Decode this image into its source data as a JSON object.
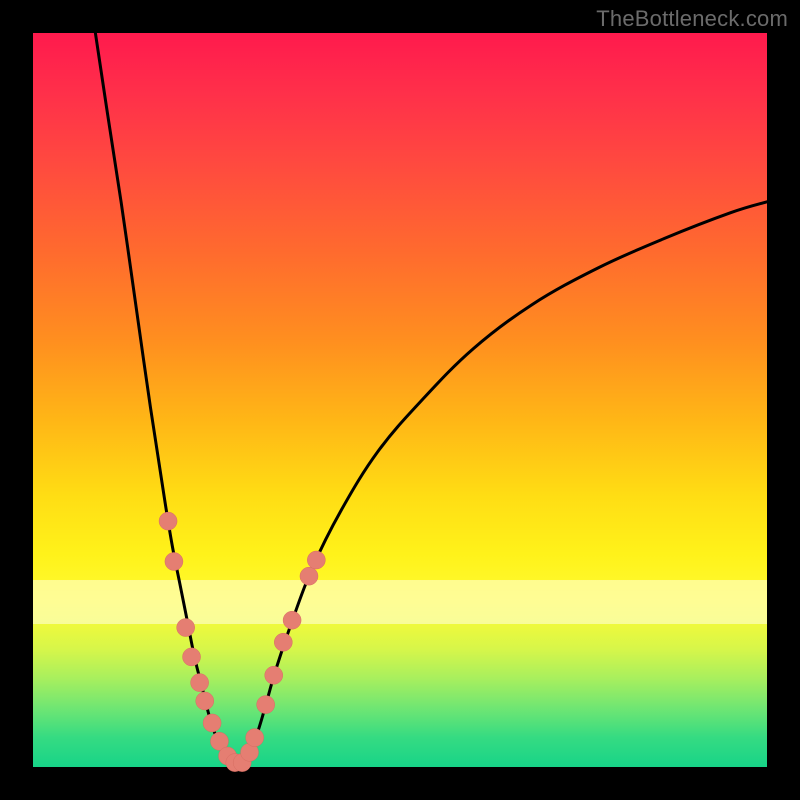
{
  "watermark": "TheBottleneck.com",
  "colors": {
    "frame_bg": "#000000",
    "gradient_stops": [
      "#ff1a4d",
      "#ff2f4a",
      "#ff4a3f",
      "#ff6b2e",
      "#ff8f1f",
      "#ffb716",
      "#ffdd14",
      "#fff21a",
      "#fffb30",
      "#f2fa3a",
      "#d6f64a",
      "#a7ef5e",
      "#6fe673",
      "#35db82",
      "#17d488"
    ],
    "curve_stroke": "#000000",
    "dot_fill": "#e57e72"
  },
  "chart_data": {
    "type": "line",
    "title": "",
    "xlabel": "",
    "ylabel": "",
    "xlim": [
      0,
      100
    ],
    "ylim": [
      0,
      100
    ],
    "note": "Two black curves descending to a common minimum near x≈26 (y≈0) forming a V; salmon dots cluster near the trough on both branches. No axes, ticks, or numeric labels are rendered.",
    "series": [
      {
        "name": "left-branch",
        "x": [
          8.5,
          10,
          12,
          14,
          16,
          18,
          19,
          20,
          21,
          22,
          23,
          24,
          25,
          26,
          27,
          28
        ],
        "y": [
          100,
          90,
          77,
          63,
          49,
          36,
          30,
          25,
          20,
          15,
          11,
          7,
          4,
          2,
          1,
          0.3
        ]
      },
      {
        "name": "right-branch",
        "x": [
          28,
          29,
          30,
          31,
          32,
          33,
          35,
          38,
          42,
          47,
          53,
          60,
          68,
          77,
          86,
          95,
          100
        ],
        "y": [
          0.3,
          1,
          3,
          6,
          9.5,
          13,
          19,
          27,
          35,
          43,
          50,
          57,
          63,
          68,
          72,
          75.5,
          77
        ]
      }
    ],
    "dots": [
      {
        "x": 18.4,
        "y": 33.5
      },
      {
        "x": 19.2,
        "y": 28.0
      },
      {
        "x": 20.8,
        "y": 19.0
      },
      {
        "x": 21.6,
        "y": 15.0
      },
      {
        "x": 22.7,
        "y": 11.5
      },
      {
        "x": 23.4,
        "y": 9.0
      },
      {
        "x": 24.4,
        "y": 6.0
      },
      {
        "x": 25.4,
        "y": 3.5
      },
      {
        "x": 26.5,
        "y": 1.5
      },
      {
        "x": 27.5,
        "y": 0.6
      },
      {
        "x": 28.5,
        "y": 0.6
      },
      {
        "x": 29.5,
        "y": 2.0
      },
      {
        "x": 30.2,
        "y": 4.0
      },
      {
        "x": 31.7,
        "y": 8.5
      },
      {
        "x": 32.8,
        "y": 12.5
      },
      {
        "x": 34.1,
        "y": 17.0
      },
      {
        "x": 35.3,
        "y": 20.0
      },
      {
        "x": 37.6,
        "y": 26.0
      },
      {
        "x": 38.6,
        "y": 28.2
      }
    ]
  }
}
